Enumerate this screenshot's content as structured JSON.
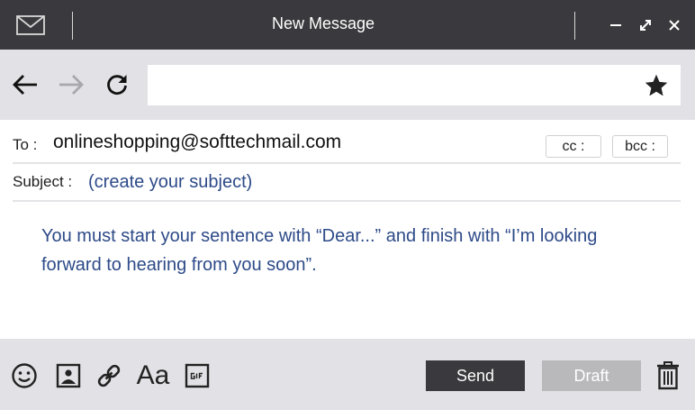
{
  "window": {
    "title": "New Message",
    "icons": {
      "app": "mail-icon",
      "minimize": "minimize-icon",
      "maximize": "maximize-icon",
      "close": "close-icon"
    }
  },
  "nav": {
    "url_value": "",
    "icons": {
      "back": "arrow-left-icon",
      "forward": "arrow-right-icon",
      "reload": "reload-icon",
      "bookmark": "star-icon"
    }
  },
  "compose": {
    "to_label": "To :",
    "to_value": "onlineshopping@softtechmail.com",
    "cc_label": "cc :",
    "bcc_label": "bcc :",
    "subject_label": "Subject :",
    "subject_value": "",
    "subject_placeholder": "(create your subject)",
    "body_text": "You must start your sentence with “Dear...” and finish with “I’m looking forward to hearing from you soon”."
  },
  "toolbar": {
    "font_label": "Aa",
    "send_label": "Send",
    "draft_label": "Draft",
    "icons": [
      "emoji-icon",
      "image-icon",
      "link-icon",
      "font-icon",
      "gif-icon",
      "trash-icon"
    ]
  },
  "colors": {
    "titlebar": "#3a3a3e",
    "panel": "#e2e2e6",
    "accent_text": "#2d4a88",
    "send_button": "#3a3a3e",
    "draft_button": "#b9b9bc"
  }
}
